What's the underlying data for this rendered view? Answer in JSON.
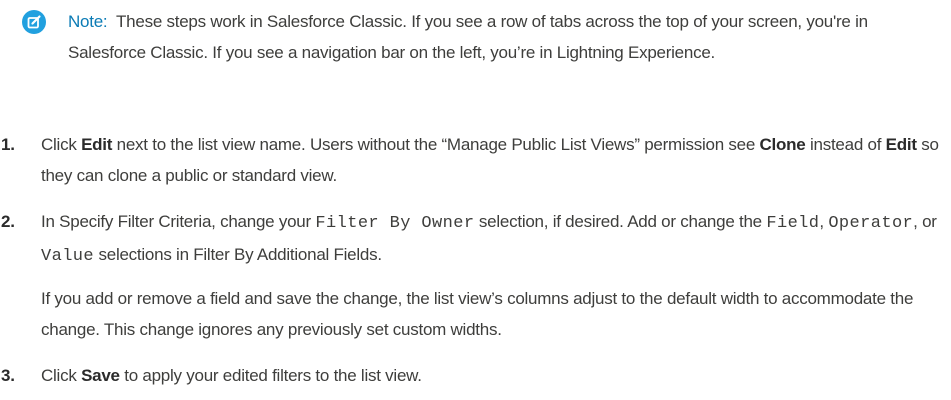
{
  "note": {
    "icon": "edit-note-icon",
    "icon_color": "#21a0df",
    "label": "Note:",
    "label_color": "#0b7bb5",
    "text": "These steps work in Salesforce Classic. If you see a row of tabs across the top of your screen, you're in Salesforce Classic. If you see a navigation bar on the left, you’re in Lightning Experience."
  },
  "steps": [
    {
      "number": "1.",
      "t1": "Click ",
      "b1": "Edit",
      "t2": " next to the list view name. Users without the “Manage Public List Views” permission see ",
      "b2": "Clone",
      "t3": " instead of ",
      "b3": "Edit",
      "t4": " so they can clone a public or standard view."
    },
    {
      "number": "2.",
      "t1": "In Specify Filter Criteria, change your ",
      "c1": "Filter By Owner",
      "t2": " selection, if desired. Add or change the ",
      "c2": "Field",
      "t3": ", ",
      "c3": "Operator",
      "t4": ", or ",
      "c4": "Value",
      "t5": " selections in Filter By Additional Fields.",
      "para2": "If you add or remove a field and save the change, the list view’s columns adjust to the default width to accommodate the change. This change ignores any previously set custom widths."
    },
    {
      "number": "3.",
      "t1": "Click ",
      "b1": "Save",
      "t2": " to apply your edited filters to the list view."
    }
  ]
}
